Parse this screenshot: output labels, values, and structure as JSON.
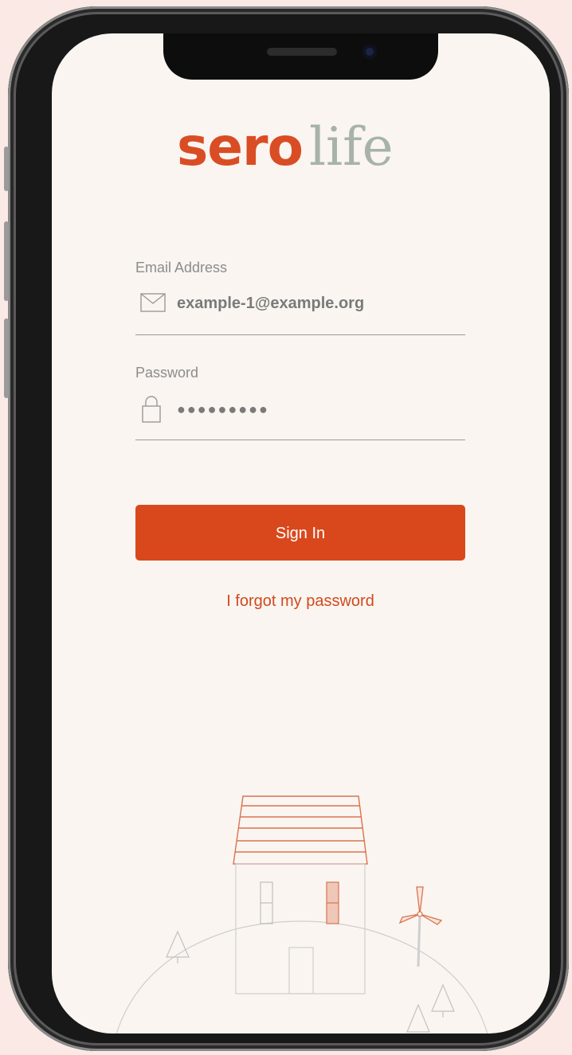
{
  "app": {
    "logo_part1": "sero",
    "logo_part2": "life",
    "brand_color": "#d94d24",
    "accent_color": "#a7b3aa"
  },
  "form": {
    "email_label": "Email Address",
    "email_value": "example-1@example.org",
    "email_icon": "envelope-icon",
    "password_label": "Password",
    "password_value": "●●●●●●●●●",
    "password_icon": "lock-icon"
  },
  "actions": {
    "sign_in_label": "Sign In",
    "forgot_label": "I forgot my password"
  },
  "illustration": {
    "name": "house-hill-illustration"
  }
}
